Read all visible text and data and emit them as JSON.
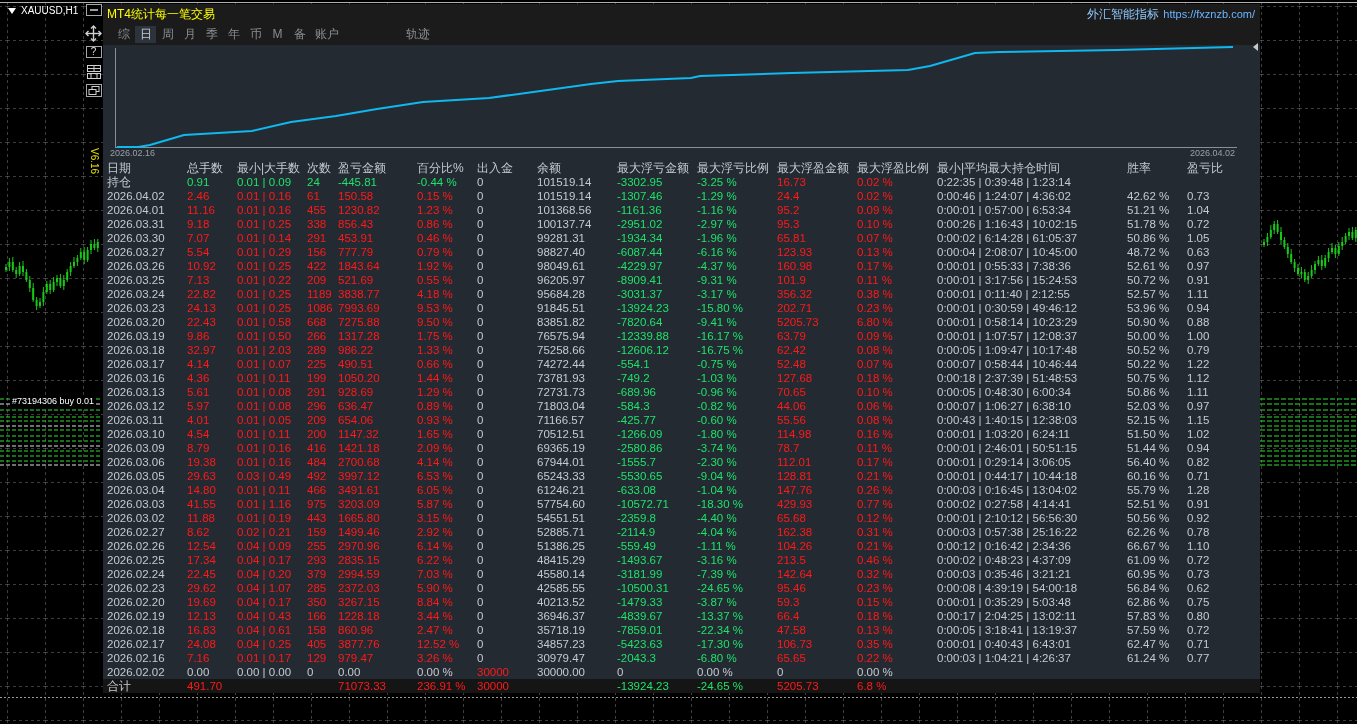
{
  "chart_window": {
    "symbol": "XAUUSD,H1",
    "version": "V6.16",
    "order_label": "#73194306 buy 0.01",
    "help_label": "?"
  },
  "panel": {
    "title": "MT4统计每一笔交易",
    "brand": "外汇智能指标",
    "link": "https://fxznzb.com/"
  },
  "tabs": [
    {
      "label": "综",
      "selected": false
    },
    {
      "label": "日",
      "selected": true
    },
    {
      "label": "周",
      "selected": false
    },
    {
      "label": "月",
      "selected": false
    },
    {
      "label": "季",
      "selected": false
    },
    {
      "label": "年",
      "selected": false
    },
    {
      "label": "币",
      "selected": false
    },
    {
      "label": "M",
      "selected": false
    },
    {
      "label": "备",
      "selected": false
    },
    {
      "label": "账户",
      "selected": false
    }
  ],
  "extra_tabs": [
    {
      "label": "轨迹",
      "selected": false
    }
  ],
  "equity_chart": {
    "start_label": "2026.02.16",
    "end_label": "2026.04.02"
  },
  "table": {
    "columns": [
      "日期",
      "总手数",
      "最小|大手数",
      "次数",
      "盈亏金额",
      "百分比%",
      "出入金",
      "余额",
      "最大浮亏金额",
      "最大浮亏比例",
      "最大浮盈金额",
      "最大浮盈比例",
      "最小|平均最大持仓时间",
      "胜率",
      "盈亏比"
    ],
    "rows": [
      {
        "kind": "open",
        "cells": [
          "持仓",
          "0.91",
          "0.01 | 0.09",
          "24",
          "-445.81",
          "-0.44 %",
          "0",
          "101519.14",
          "-3302.95",
          "-3.25 %",
          "16.73",
          "0.02 %",
          "0:22:35 | 0:39:48 | 1:23:14",
          null,
          null
        ]
      },
      {
        "kind": "day",
        "cells": [
          "2026.04.02",
          "2.46",
          "0.01 | 0.16",
          "61",
          "150.58",
          "0.15 %",
          "0",
          "101519.14",
          "-1307.46",
          "-1.29 %",
          "24.4",
          "0.02 %",
          "0:00:46 | 1:24:07 | 4:36:02",
          "42.62 %",
          "0.73"
        ]
      },
      {
        "kind": "day",
        "cells": [
          "2026.04.01",
          "11.16",
          "0.01 | 0.16",
          "455",
          "1230.82",
          "1.23 %",
          "0",
          "101368.56",
          "-1161.36",
          "-1.16 %",
          "95.2",
          "0.09 %",
          "0:00:01 | 0:57:00 | 6:53:34",
          "51.21 %",
          "1.04"
        ]
      },
      {
        "kind": "day",
        "cells": [
          "2026.03.31",
          "9.18",
          "0.01 | 0.25",
          "338",
          "856.43",
          "0.86 %",
          "0",
          "100137.74",
          "-2951.02",
          "-2.97 %",
          "95.3",
          "0.10 %",
          "0:00:26 | 1:16:43 | 10:02:15",
          "51.78 %",
          "0.72"
        ]
      },
      {
        "kind": "day",
        "cells": [
          "2026.03.30",
          "7.07",
          "0.01 | 0.14",
          "291",
          "453.91",
          "0.46 %",
          "0",
          "99281.31",
          "-1934.34",
          "-1.96 %",
          "65.81",
          "0.07 %",
          "0:00:02 | 6:14:28 | 61:05:37",
          "50.86 %",
          "1.05"
        ]
      },
      {
        "kind": "day",
        "cells": [
          "2026.03.27",
          "5.54",
          "0.01 | 0.29",
          "156",
          "777.79",
          "0.79 %",
          "0",
          "98827.40",
          "-6087.44",
          "-6.16 %",
          "123.93",
          "0.13 %",
          "0:00:04 | 2:08:07 | 10:45:00",
          "48.72 %",
          "0.63"
        ]
      },
      {
        "kind": "day",
        "cells": [
          "2026.03.26",
          "10.92",
          "0.01 | 0.25",
          "422",
          "1843.64",
          "1.92 %",
          "0",
          "98049.61",
          "-4229.97",
          "-4.37 %",
          "160.98",
          "0.17 %",
          "0:00:01 | 0:55:33 | 7:38:36",
          "52.61 %",
          "0.97"
        ]
      },
      {
        "kind": "day",
        "cells": [
          "2026.03.25",
          "7.13",
          "0.01 | 0.22",
          "209",
          "521.69",
          "0.55 %",
          "0",
          "96205.97",
          "-8909.41",
          "-9.31 %",
          "101.9",
          "0.11 %",
          "0:00:01 | 3:17:56 | 15:24:53",
          "50.72 %",
          "0.91"
        ]
      },
      {
        "kind": "day",
        "cells": [
          "2026.03.24",
          "22.82",
          "0.01 | 0.25",
          "1189",
          "3838.77",
          "4.18 %",
          "0",
          "95684.28",
          "-3031.37",
          "-3.17 %",
          "356.32",
          "0.38 %",
          "0:00:01 | 0:11:40 | 2:12:55",
          "52.57 %",
          "1.11"
        ]
      },
      {
        "kind": "day",
        "cells": [
          "2026.03.23",
          "24.13",
          "0.01 | 0.25",
          "1086",
          "7993.69",
          "9.53 %",
          "0",
          "91845.51",
          "-13924.23",
          "-15.80 %",
          "202.71",
          "0.23 %",
          "0:00:01 | 0:30:59 | 49:46:12",
          "53.96 %",
          "0.94"
        ]
      },
      {
        "kind": "day",
        "cells": [
          "2026.03.20",
          "22.43",
          "0.01 | 0.58",
          "668",
          "7275.88",
          "9.50 %",
          "0",
          "83851.82",
          "-7820.64",
          "-9.41 %",
          "5205.73",
          "6.80 %",
          "0:00:01 | 0:58:14 | 10:23:29",
          "50.90 %",
          "0.88"
        ]
      },
      {
        "kind": "day",
        "cells": [
          "2026.03.19",
          "9.86",
          "0.01 | 0.50",
          "266",
          "1317.28",
          "1.75 %",
          "0",
          "76575.94",
          "-12339.88",
          "-16.17 %",
          "63.79",
          "0.09 %",
          "0:00:01 | 1:07:57 | 12:08:37",
          "50.00 %",
          "1.00"
        ]
      },
      {
        "kind": "day",
        "cells": [
          "2026.03.18",
          "32.97",
          "0.01 | 2.03",
          "289",
          "986.22",
          "1.33 %",
          "0",
          "75258.66",
          "-12606.12",
          "-16.75 %",
          "62.42",
          "0.08 %",
          "0:00:05 | 1:09:47 | 10:17:48",
          "50.52 %",
          "0.79"
        ]
      },
      {
        "kind": "day",
        "cells": [
          "2026.03.17",
          "4.14",
          "0.01 | 0.07",
          "225",
          "490.51",
          "0.66 %",
          "0",
          "74272.44",
          "-554.1",
          "-0.75 %",
          "52.48",
          "0.07 %",
          "0:00:07 | 0:58:44 | 10:46:44",
          "50.22 %",
          "1.22"
        ]
      },
      {
        "kind": "day",
        "cells": [
          "2026.03.16",
          "4.36",
          "0.01 | 0.11",
          "199",
          "1050.20",
          "1.44 %",
          "0",
          "73781.93",
          "-749.2",
          "-1.03 %",
          "127.68",
          "0.18 %",
          "0:00:18 | 2:37:39 | 51:48:53",
          "50.75 %",
          "1.12"
        ]
      },
      {
        "kind": "day",
        "cells": [
          "2026.03.13",
          "5.61",
          "0.01 | 0.08",
          "291",
          "928.69",
          "1.29 %",
          "0",
          "72731.73",
          "-689.96",
          "-0.96 %",
          "70.65",
          "0.10 %",
          "0:00:05 | 0:48:30 | 6:00:34",
          "50.86 %",
          "1.11"
        ]
      },
      {
        "kind": "day",
        "cells": [
          "2026.03.12",
          "5.97",
          "0.01 | 0.08",
          "296",
          "636.47",
          "0.89 %",
          "0",
          "71803.04",
          "-584.3",
          "-0.82 %",
          "44.06",
          "0.06 %",
          "0:00:07 | 1:06:27 | 6:38:10",
          "52.03 %",
          "0.97"
        ]
      },
      {
        "kind": "day",
        "cells": [
          "2026.03.11",
          "4.01",
          "0.01 | 0.05",
          "209",
          "654.06",
          "0.93 %",
          "0",
          "71166.57",
          "-425.77",
          "-0.60 %",
          "55.56",
          "0.08 %",
          "0:00:43 | 1:40:15 | 12:38:03",
          "52.15 %",
          "1.15"
        ]
      },
      {
        "kind": "day",
        "cells": [
          "2026.03.10",
          "4.54",
          "0.01 | 0.11",
          "200",
          "1147.32",
          "1.65 %",
          "0",
          "70512.51",
          "-1266.09",
          "-1.80 %",
          "114.98",
          "0.16 %",
          "0:00:01 | 1:03:20 | 6:24:11",
          "51.50 %",
          "1.02"
        ]
      },
      {
        "kind": "day",
        "cells": [
          "2026.03.09",
          "8.79",
          "0.01 | 0.16",
          "416",
          "1421.18",
          "2.09 %",
          "0",
          "69365.19",
          "-2580.86",
          "-3.74 %",
          "78.7",
          "0.11 %",
          "0:00:01 | 2:46:01 | 50:51:15",
          "51.44 %",
          "0.94"
        ]
      },
      {
        "kind": "day",
        "cells": [
          "2026.03.06",
          "19.38",
          "0.01 | 0.16",
          "484",
          "2700.68",
          "4.14 %",
          "0",
          "67944.01",
          "-1555.7",
          "-2.30 %",
          "112.01",
          "0.17 %",
          "0:00:01 | 0:29:14 | 3:06:05",
          "56.40 %",
          "0.82"
        ]
      },
      {
        "kind": "day",
        "cells": [
          "2026.03.05",
          "29.63",
          "0.03 | 0.49",
          "492",
          "3997.12",
          "6.53 %",
          "0",
          "65243.33",
          "-5530.65",
          "-9.04 %",
          "128.81",
          "0.21 %",
          "0:00:01 | 0:44:17 | 10:44:18",
          "60.16 %",
          "0.71"
        ]
      },
      {
        "kind": "day",
        "cells": [
          "2026.03.04",
          "14.80",
          "0.01 | 0.11",
          "466",
          "3491.61",
          "6.05 %",
          "0",
          "61246.21",
          "-633.08",
          "-1.04 %",
          "147.76",
          "0.26 %",
          "0:00:03 | 0:16:45 | 13:04:02",
          "55.79 %",
          "1.28"
        ]
      },
      {
        "kind": "day",
        "cells": [
          "2026.03.03",
          "41.55",
          "0.01 | 1.16",
          "975",
          "3203.09",
          "5.87 %",
          "0",
          "57754.60",
          "-10572.71",
          "-18.30 %",
          "429.93",
          "0.77 %",
          "0:00:02 | 0:27:58 | 4:14:41",
          "52.51 %",
          "0.91"
        ]
      },
      {
        "kind": "day",
        "cells": [
          "2026.03.02",
          "11.88",
          "0.01 | 0.19",
          "443",
          "1665.80",
          "3.15 %",
          "0",
          "54551.51",
          "-2359.8",
          "-4.40 %",
          "65.68",
          "0.12 %",
          "0:00:01 | 2:10:12 | 56:56:30",
          "50.56 %",
          "0.92"
        ]
      },
      {
        "kind": "day",
        "cells": [
          "2026.02.27",
          "8.62",
          "0.02 | 0.21",
          "159",
          "1499.46",
          "2.92 %",
          "0",
          "52885.71",
          "-2114.9",
          "-4.04 %",
          "162.38",
          "0.31 %",
          "0:00:03 | 0:57:38 | 25:16:22",
          "62.26 %",
          "0.78"
        ]
      },
      {
        "kind": "day",
        "cells": [
          "2026.02.26",
          "12.54",
          "0.04 | 0.09",
          "255",
          "2970.96",
          "6.14 %",
          "0",
          "51386.25",
          "-559.49",
          "-1.11 %",
          "104.26",
          "0.21 %",
          "0:00:12 | 0:16:42 | 2:34:36",
          "66.67 %",
          "1.10"
        ]
      },
      {
        "kind": "day",
        "cells": [
          "2026.02.25",
          "17.34",
          "0.04 | 0.17",
          "293",
          "2835.15",
          "6.22 %",
          "0",
          "48415.29",
          "-1493.67",
          "-3.16 %",
          "213.5",
          "0.46 %",
          "0:00:02 | 0:48:23 | 4:37:09",
          "61.09 %",
          "0.72"
        ]
      },
      {
        "kind": "day",
        "cells": [
          "2026.02.24",
          "22.45",
          "0.04 | 0.20",
          "379",
          "2994.59",
          "7.03 %",
          "0",
          "45580.14",
          "-3181.99",
          "-7.39 %",
          "142.64",
          "0.32 %",
          "0:00:03 | 0:35:46 | 3:21:21",
          "60.95 %",
          "0.73"
        ]
      },
      {
        "kind": "day",
        "cells": [
          "2026.02.23",
          "29.62",
          "0.04 | 1.07",
          "285",
          "2372.03",
          "5.90 %",
          "0",
          "42585.55",
          "-10500.31",
          "-24.65 %",
          "95.46",
          "0.23 %",
          "0:00:08 | 4:39:19 | 54:00:18",
          "56.84 %",
          "0.62"
        ]
      },
      {
        "kind": "day",
        "cells": [
          "2026.02.20",
          "19.69",
          "0.04 | 0.17",
          "350",
          "3267.15",
          "8.84 %",
          "0",
          "40213.52",
          "-1479.33",
          "-3.87 %",
          "59.3",
          "0.15 %",
          "0:00:01 | 0:35:29 | 5:03:48",
          "62.86 %",
          "0.75"
        ]
      },
      {
        "kind": "day",
        "cells": [
          "2026.02.19",
          "12.13",
          "0.04 | 0.43",
          "166",
          "1228.18",
          "3.44 %",
          "0",
          "36946.37",
          "-4839.67",
          "-13.37 %",
          "66.4",
          "0.18 %",
          "0:00:17 | 2:04:25 | 13:02:11",
          "57.83 %",
          "0.80"
        ]
      },
      {
        "kind": "day",
        "cells": [
          "2026.02.18",
          "16.83",
          "0.04 | 0.61",
          "158",
          "860.96",
          "2.47 %",
          "0",
          "35718.19",
          "-7859.01",
          "-22.34 %",
          "47.58",
          "0.13 %",
          "0:00:05 | 3:18:41 | 13:19:37",
          "57.59 %",
          "0.72"
        ]
      },
      {
        "kind": "day",
        "cells": [
          "2026.02.17",
          "24.08",
          "0.04 | 0.25",
          "405",
          "3877.76",
          "12.52 %",
          "0",
          "34857.23",
          "-5423.63",
          "-17.30 %",
          "106.73",
          "0.35 %",
          "0:00:01 | 0:40:43 | 6:43:01",
          "62.47 %",
          "0.71"
        ]
      },
      {
        "kind": "day",
        "cells": [
          "2026.02.16",
          "7.16",
          "0.01 | 0.17",
          "129",
          "979.47",
          "3.26 %",
          "0",
          "30979.47",
          "-2043.3",
          "-6.80 %",
          "65.65",
          "0.22 %",
          "0:00:03 | 1:04:21 | 4:26:37",
          "61.24 %",
          "0.77"
        ]
      },
      {
        "kind": "deposit",
        "cells": [
          "2026.02.02",
          "0.00",
          "0.00 | 0.00",
          "0",
          "0.00",
          "0.00 %",
          "30000",
          "30000.00",
          "0",
          "0.00 %",
          "0",
          "0.00 %",
          null,
          null,
          null
        ]
      },
      {
        "kind": "total",
        "cells": [
          "合计",
          "491.70",
          null,
          null,
          "71073.33",
          "236.91 %",
          "30000",
          null,
          "-13924.23",
          "-24.65 %",
          "5205.73",
          "6.8 %",
          null,
          null,
          null
        ]
      }
    ]
  }
}
